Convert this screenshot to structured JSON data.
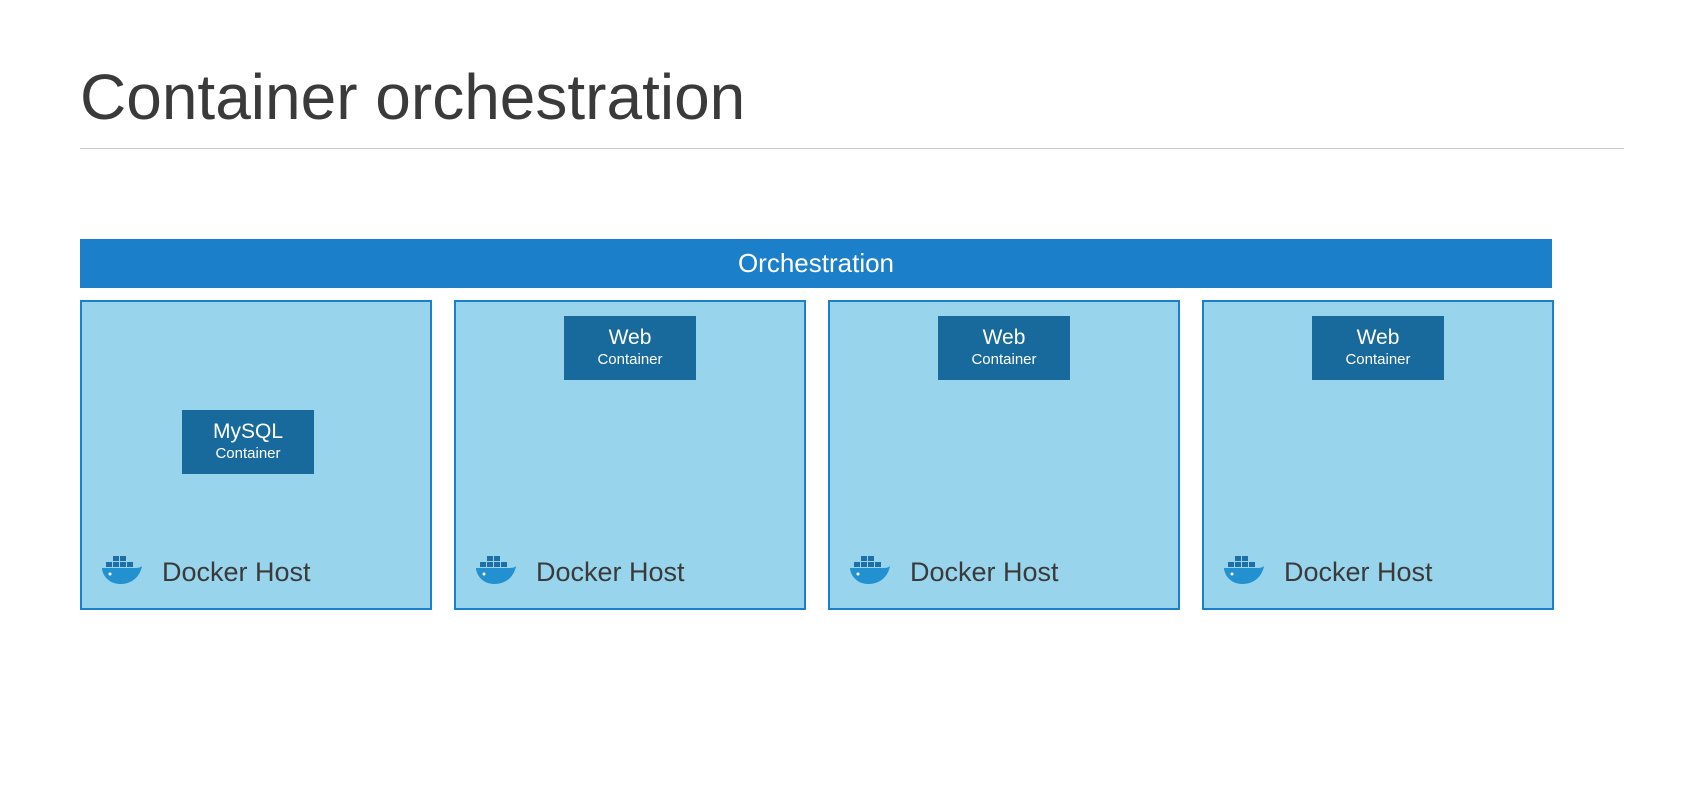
{
  "title": "Container orchestration",
  "orchestration_label": "Orchestration",
  "hosts": [
    {
      "container_title": "MySQL",
      "container_sub": "Container",
      "host_label": "Docker Host",
      "style": "mysql"
    },
    {
      "container_title": "Web",
      "container_sub": "Container",
      "host_label": "Docker Host",
      "style": "web"
    },
    {
      "container_title": "Web",
      "container_sub": "Container",
      "host_label": "Docker Host",
      "style": "web"
    },
    {
      "container_title": "Web",
      "container_sub": "Container",
      "host_label": "Docker Host",
      "style": "web"
    }
  ],
  "colors": {
    "bar": "#1c7fc9",
    "host_bg": "#98d4ec",
    "host_border": "#1c7fc9",
    "badge": "#186a9c"
  }
}
